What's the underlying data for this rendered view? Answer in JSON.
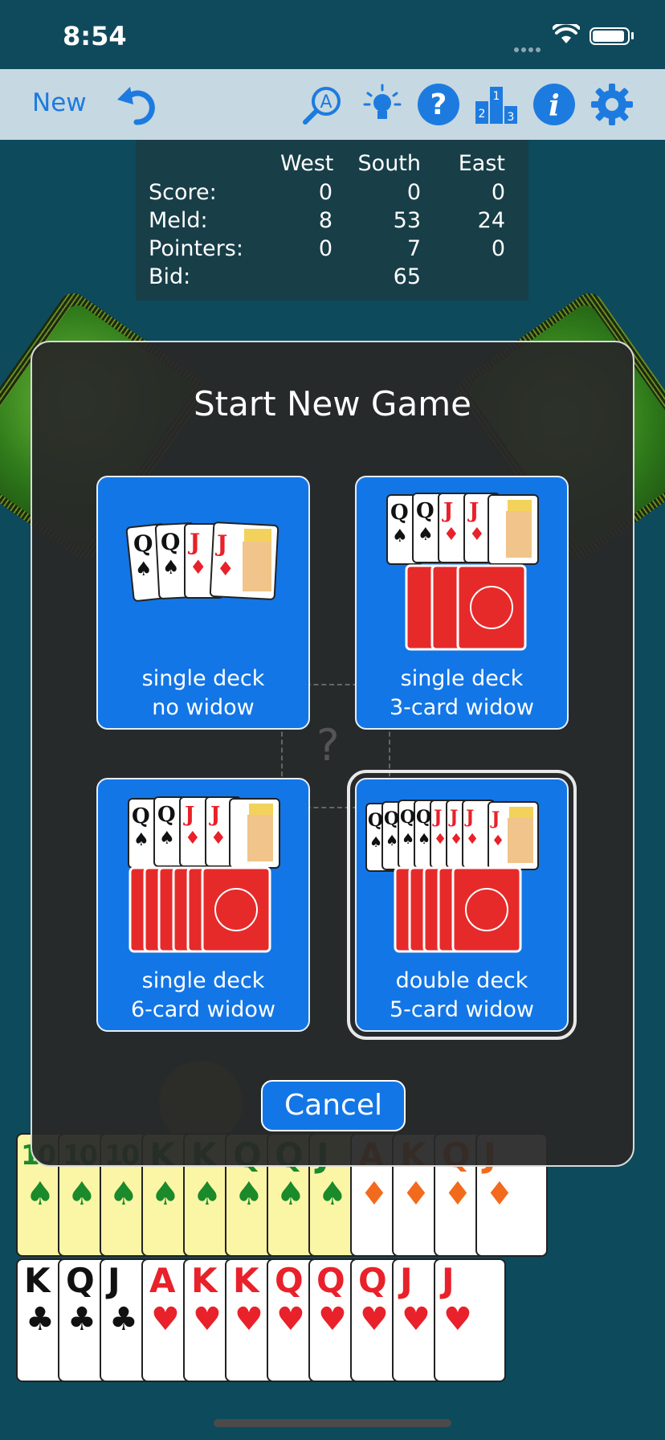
{
  "status": {
    "time": "8:54"
  },
  "toolbar": {
    "new_label": "New",
    "icons": [
      "undo-icon",
      "hint-search-icon",
      "lightbulb-icon",
      "help-icon",
      "leaderboard-icon",
      "info-icon",
      "settings-icon"
    ]
  },
  "score": {
    "headers": [
      "West",
      "South",
      "East"
    ],
    "rows": [
      {
        "label": "Score:",
        "values": [
          "0",
          "0",
          "0"
        ]
      },
      {
        "label": "Meld:",
        "values": [
          "8",
          "53",
          "24"
        ]
      },
      {
        "label": "Pointers:",
        "values": [
          "0",
          "7",
          "0"
        ]
      },
      {
        "label": "Bid:",
        "values": [
          "",
          "65",
          ""
        ]
      }
    ]
  },
  "dialog": {
    "title": "Start New Game",
    "ghost_mark": "?",
    "options": [
      {
        "line1": "single deck",
        "line2": "no widow",
        "selected": false
      },
      {
        "line1": "single deck",
        "line2": "3-card widow",
        "selected": false
      },
      {
        "line1": "single deck",
        "line2": "6-card widow",
        "selected": false
      },
      {
        "line1": "double deck",
        "line2": "5-card widow",
        "selected": true
      }
    ],
    "cancel_label": "Cancel"
  },
  "hand": {
    "row1": [
      {
        "rank": "10",
        "suit": "♠",
        "color": "green",
        "bg": "yellow"
      },
      {
        "rank": "10",
        "suit": "♠",
        "color": "green",
        "bg": "yellow"
      },
      {
        "rank": "10",
        "suit": "♠",
        "color": "green",
        "bg": "yellow"
      },
      {
        "rank": "K",
        "suit": "♠",
        "color": "green",
        "bg": "yellow"
      },
      {
        "rank": "K",
        "suit": "♠",
        "color": "green",
        "bg": "yellow"
      },
      {
        "rank": "Q",
        "suit": "♠",
        "color": "green",
        "bg": "yellow"
      },
      {
        "rank": "Q",
        "suit": "♠",
        "color": "green",
        "bg": "yellow"
      },
      {
        "rank": "J",
        "suit": "♠",
        "color": "green",
        "bg": "yellow"
      },
      {
        "rank": "A",
        "suit": "♦",
        "color": "orange",
        "bg": "white"
      },
      {
        "rank": "K",
        "suit": "♦",
        "color": "orange",
        "bg": "white"
      },
      {
        "rank": "Q",
        "suit": "♦",
        "color": "orange",
        "bg": "white"
      },
      {
        "rank": "J",
        "suit": "♦",
        "color": "orange",
        "bg": "white"
      }
    ],
    "row2": [
      {
        "rank": "K",
        "suit": "♣",
        "color": "black",
        "bg": "white"
      },
      {
        "rank": "Q",
        "suit": "♣",
        "color": "black",
        "bg": "white"
      },
      {
        "rank": "J",
        "suit": "♣",
        "color": "black",
        "bg": "white"
      },
      {
        "rank": "A",
        "suit": "♥",
        "color": "red",
        "bg": "white"
      },
      {
        "rank": "K",
        "suit": "♥",
        "color": "red",
        "bg": "white"
      },
      {
        "rank": "K",
        "suit": "♥",
        "color": "red",
        "bg": "white"
      },
      {
        "rank": "Q",
        "suit": "♥",
        "color": "red",
        "bg": "white"
      },
      {
        "rank": "Q",
        "suit": "♥",
        "color": "red",
        "bg": "white"
      },
      {
        "rank": "Q",
        "suit": "♥",
        "color": "red",
        "bg": "white"
      },
      {
        "rank": "J",
        "suit": "♥",
        "color": "red",
        "bg": "white"
      },
      {
        "rank": "J",
        "suit": "♥",
        "color": "red",
        "bg": "white"
      }
    ]
  },
  "colors": {
    "table": "#0d4a5c",
    "toolbar": "#c6d8e1",
    "accent": "#1376e6",
    "icon_blue": "#1d7be0"
  }
}
